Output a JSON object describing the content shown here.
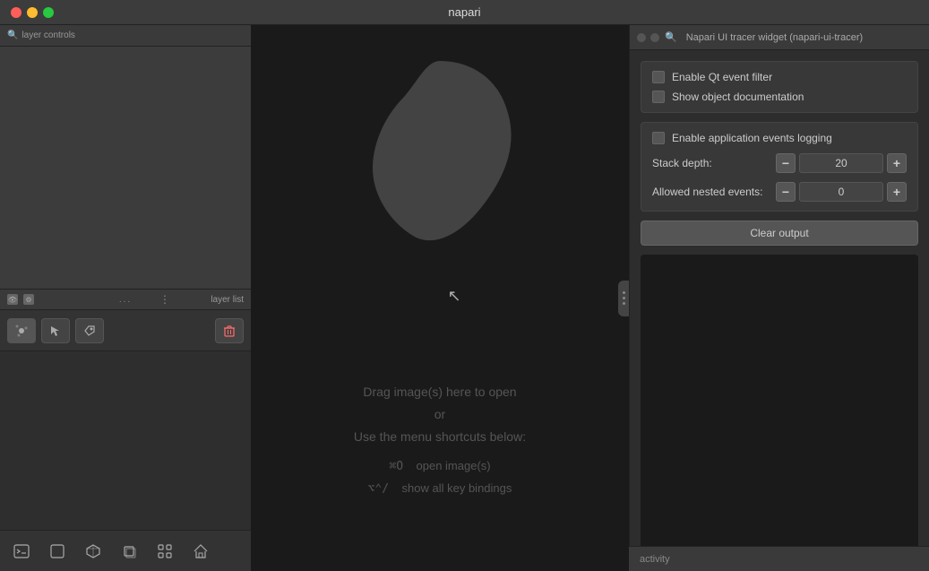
{
  "titlebar": {
    "title": "napari"
  },
  "left_panel": {
    "layer_controls_label": "layer controls",
    "separator_label": "layer list",
    "dots": "...",
    "toolbar": {
      "point_tool": "✦",
      "select_tool": "▲",
      "label_tool": "🏷",
      "delete_tool": "🗑"
    }
  },
  "bottom_toolbar": {
    "console_icon": "⌨",
    "square_icon": "□",
    "cube_icon": "⬡",
    "layers_icon": "⧉",
    "grid_icon": "⊞",
    "home_icon": "⌂"
  },
  "canvas": {
    "drop_text_line1": "Drag image(s) here to open",
    "drop_text_line2": "or",
    "drop_text_line3": "Use the menu shortcuts below:",
    "shortcut1_key": "⌘O",
    "shortcut1_label": "open image(s)",
    "shortcut2_key": "⌥⌃/",
    "shortcut2_label": "show all key bindings"
  },
  "right_panel": {
    "title": "Napari UI tracer widget (napari-ui-tracer)",
    "checkboxes": {
      "qt_filter_label": "Enable Qt event filter",
      "obj_doc_label": "Show object documentation",
      "logging_label": "Enable application events logging"
    },
    "stack_depth": {
      "label": "Stack depth:",
      "value": "20"
    },
    "nested_events": {
      "label": "Allowed nested events:",
      "value": "0"
    },
    "clear_button": "Clear output",
    "minus_symbol": "−",
    "plus_symbol": "+"
  },
  "activity": {
    "label": "activity"
  }
}
